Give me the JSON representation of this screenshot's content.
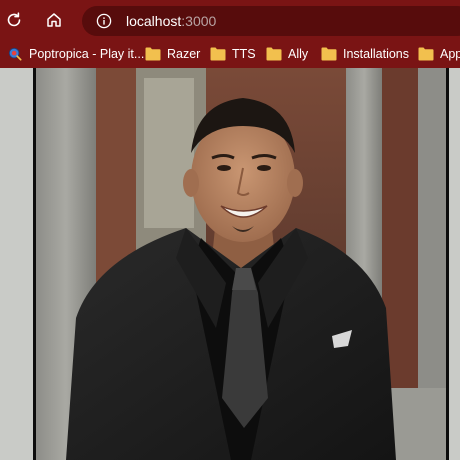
{
  "browser": {
    "url_host": "localhost",
    "url_port": ":3000"
  },
  "bookmarks": [
    {
      "label": "Poptropica - Play it...",
      "icon": "poptropica-favicon"
    },
    {
      "label": "Razer",
      "icon": "folder-icon"
    },
    {
      "label": "TTS",
      "icon": "folder-icon"
    },
    {
      "label": "Ally",
      "icon": "folder-icon"
    },
    {
      "label": "Installations",
      "icon": "folder-icon"
    },
    {
      "label": "App",
      "icon": "folder-icon"
    }
  ],
  "photo": {
    "subject": "portrait-photo"
  },
  "colors": {
    "toolbar": "#7a1414",
    "omnibox": "#570c0c",
    "folder": "#f2c04e",
    "page_background": "#c9cbc7"
  }
}
